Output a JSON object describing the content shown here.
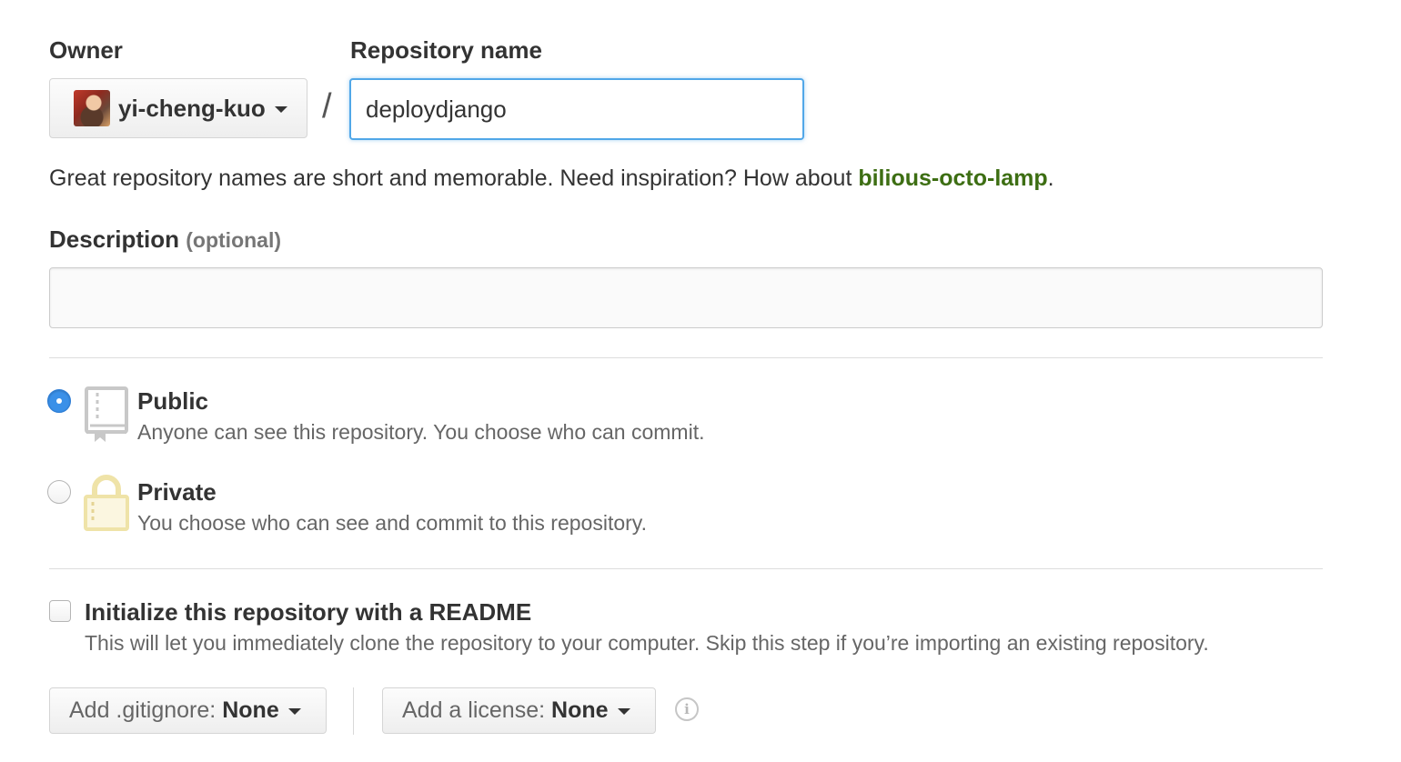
{
  "owner": {
    "label": "Owner",
    "selected": "yi-cheng-kuo"
  },
  "repo_name": {
    "label": "Repository name",
    "value": "deploydjango",
    "separator": "/"
  },
  "hint": {
    "prefix": "Great repository names are short and memorable. Need inspiration? How about ",
    "suggestion": "bilious-octo-lamp",
    "suffix": "."
  },
  "description": {
    "label": "Description",
    "optional": "(optional)",
    "value": ""
  },
  "visibility": {
    "public": {
      "title": "Public",
      "desc": "Anyone can see this repository. You choose who can commit.",
      "selected": true
    },
    "private": {
      "title": "Private",
      "desc": "You choose who can see and commit to this repository.",
      "selected": false
    }
  },
  "readme": {
    "title": "Initialize this repository with a README",
    "desc": "This will let you immediately clone the repository to your computer. Skip this step if you’re importing an existing repository.",
    "checked": false
  },
  "gitignore": {
    "label": "Add .gitignore:",
    "value": "None"
  },
  "license": {
    "label": "Add a license:",
    "value": "None"
  },
  "icons": {
    "public": "repo-book-icon",
    "private": "lock-icon",
    "info": "info-icon",
    "caret": "caret-down-icon"
  },
  "colors": {
    "accent_blue": "#3a90e8",
    "focus_border": "#51a7e8",
    "suggestion_green": "#3d6e13",
    "lock_fill": "#f2e8b8",
    "lock_stroke": "#e0cf8a"
  }
}
